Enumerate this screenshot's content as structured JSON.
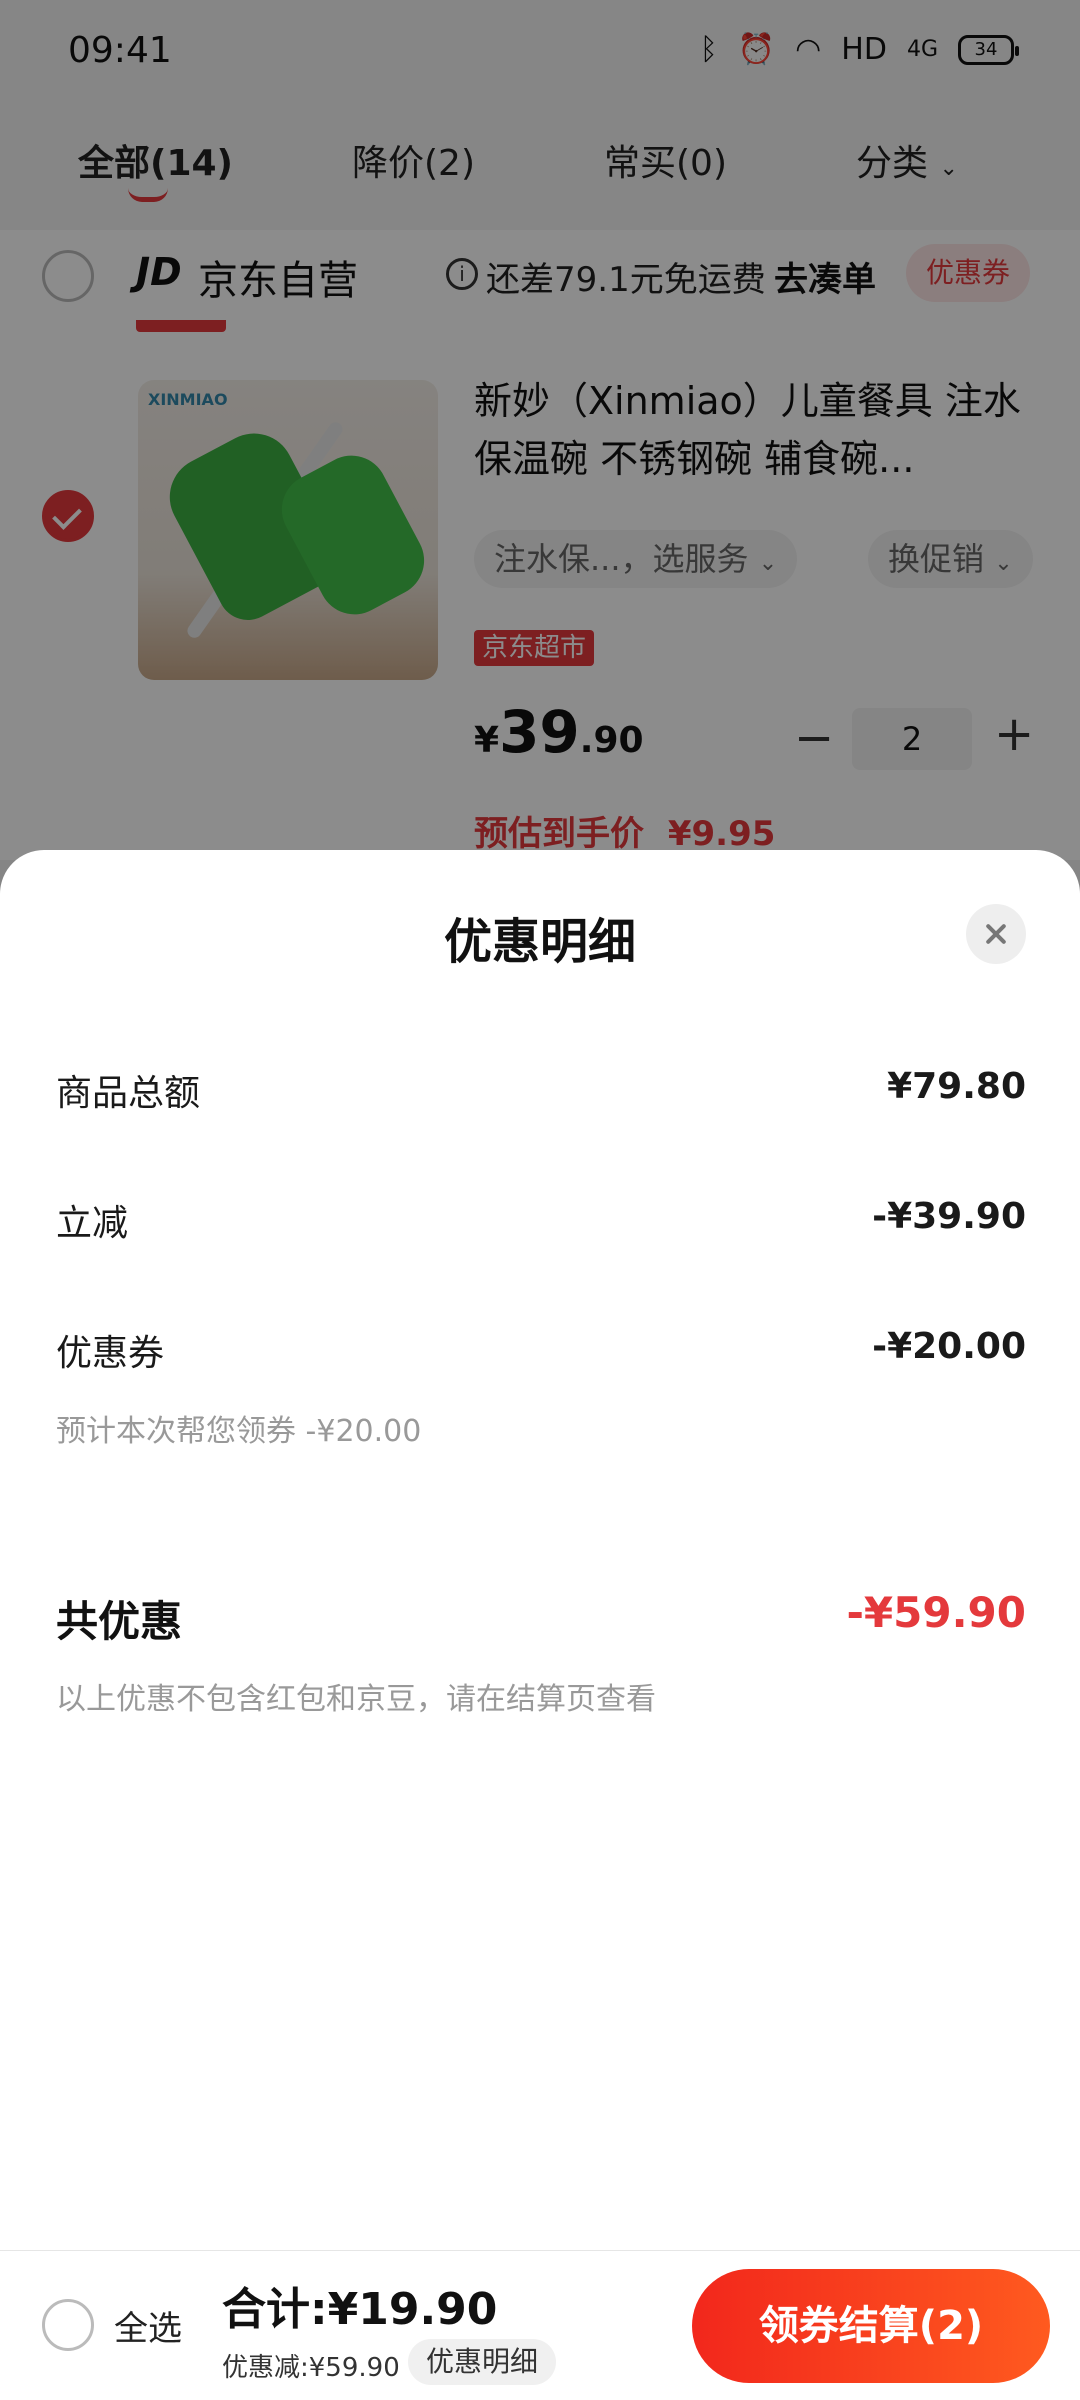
{
  "status_bar": {
    "time": "09:41",
    "network": "HD",
    "signal": "4G",
    "battery": "34"
  },
  "tabs": [
    {
      "label": "全部(14)"
    },
    {
      "label": "降价(2)"
    },
    {
      "label": "常买(0)"
    },
    {
      "label": "分类"
    }
  ],
  "store": {
    "logo": "JD",
    "name": "京东自营",
    "shipping_note": "还差79.1元免运费",
    "go_add": "去凑单",
    "coupon": "优惠券"
  },
  "product": {
    "title": "新妙（Xinmiao）儿童餐具 注水保温碗 不锈钢碗 辅食碗...",
    "brand_mark": "XINMIAO",
    "option_service": "注水保...，选服务",
    "option_promo": "换促销",
    "tag": "京东超市",
    "price_currency": "¥",
    "price_int": "39",
    "price_dec": ".90",
    "quantity": "2",
    "minus": "−",
    "plus": "+",
    "estimate_label": "预估到手价",
    "estimate_value": "¥9.95"
  },
  "sheet": {
    "title": "优惠明细",
    "rows": [
      {
        "label": "商品总额",
        "value": "¥79.80"
      },
      {
        "label": "立减",
        "value": "-¥39.90"
      },
      {
        "label": "优惠券",
        "value": "-¥20.00",
        "sub": "预计本次帮您领券 -¥20.00"
      }
    ],
    "total_label": "共优惠",
    "total_value": "-¥59.90",
    "note": "以上优惠不包含红包和京豆，请在结算页查看"
  },
  "checkout": {
    "select_all": "全选",
    "sum": "合计:¥19.90",
    "discount": "优惠减:¥59.90",
    "detail": "优惠明细",
    "button": "领券结算(2)"
  },
  "colors": {
    "accent": "#e4393c",
    "button_start": "#f2271c",
    "button_end": "#ff5a1f"
  },
  "icons": [
    "bluetooth-icon",
    "alarm-icon",
    "wifi-icon",
    "signal-icon",
    "battery-icon",
    "info-icon",
    "chevron-down-icon",
    "close-icon",
    "check-icon"
  ]
}
